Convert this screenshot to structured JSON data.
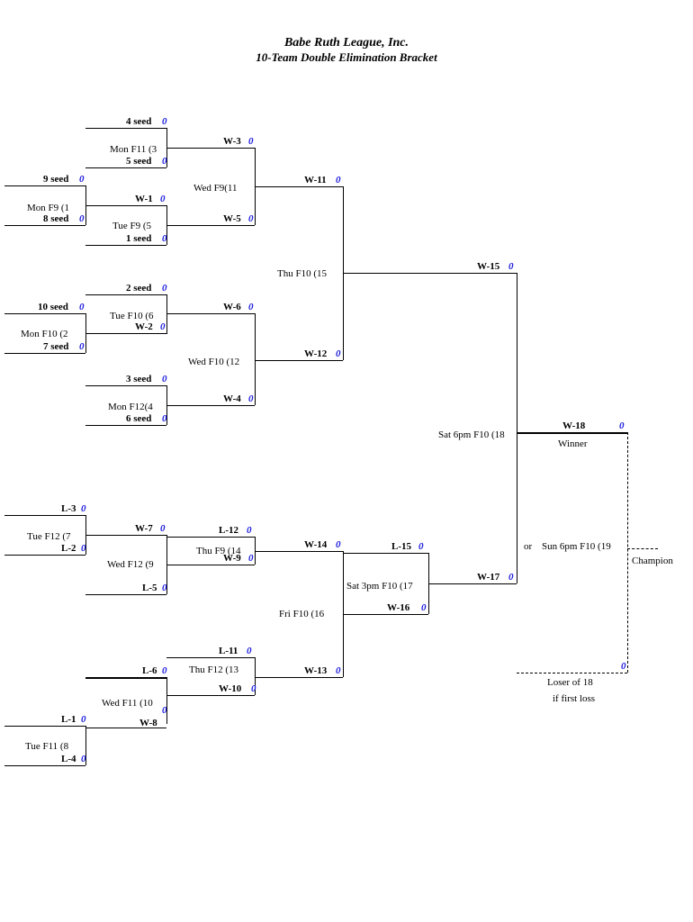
{
  "header": {
    "title": "Babe Ruth League, Inc.",
    "subtitle": "10-Team Double Elimination Bracket"
  },
  "seeds": {
    "s4": "4 seed",
    "s5": "5 seed",
    "s9": "9 seed",
    "s8": "8 seed",
    "s1": "1 seed",
    "s2": "2 seed",
    "s10": "10 seed",
    "s7": "7 seed",
    "s3": "3 seed",
    "s6": "6 seed"
  },
  "games": {
    "g1": "Mon F9 (1",
    "g2": "Mon F10 (2",
    "g3": "Mon F11 (3",
    "g4": "Mon F12(4",
    "g5": "Tue F9 (5",
    "g6": "Tue F10 (6",
    "g7": "Tue F12 (7",
    "g8": "Tue F11 (8",
    "g9": "Wed F12 (9",
    "g10": "Wed F11 (10",
    "g11": "Wed F9(11",
    "g12": "Wed F10 (12",
    "g13": "Thu F12 (13",
    "g14": "Thu F9 (14",
    "g15": "Thu F10 (15",
    "g16": "Fri F10 (16",
    "g17": "Sat 3pm F10 (17",
    "g18": "Sat 6pm F10 (18",
    "g19": "Sun 6pm F10 (19"
  },
  "advance": {
    "w1": "W-1",
    "w2": "W-2",
    "w3": "W-3",
    "w4": "W-4",
    "w5": "W-5",
    "w6": "W-6",
    "w7": "W-7",
    "w8": "W-8",
    "w9": "W-9",
    "w10": "W-10",
    "w11": "W-11",
    "w12": "W-12",
    "w13": "W-13",
    "w14": "W-14",
    "w15": "W-15",
    "w16": "W-16",
    "w17": "W-17",
    "w18": "W-18",
    "l1": "L-1",
    "l2": "L-2",
    "l3": "L-3",
    "l4": "L-4",
    "l5": "L-5",
    "l6": "L-6",
    "l11": "L-11",
    "l12": "L-12",
    "l15": "L-15"
  },
  "text": {
    "winner": "Winner",
    "or": "or",
    "champion": "Champion",
    "loser18": "Loser of 18",
    "firstloss": "if first loss"
  },
  "score": "0"
}
